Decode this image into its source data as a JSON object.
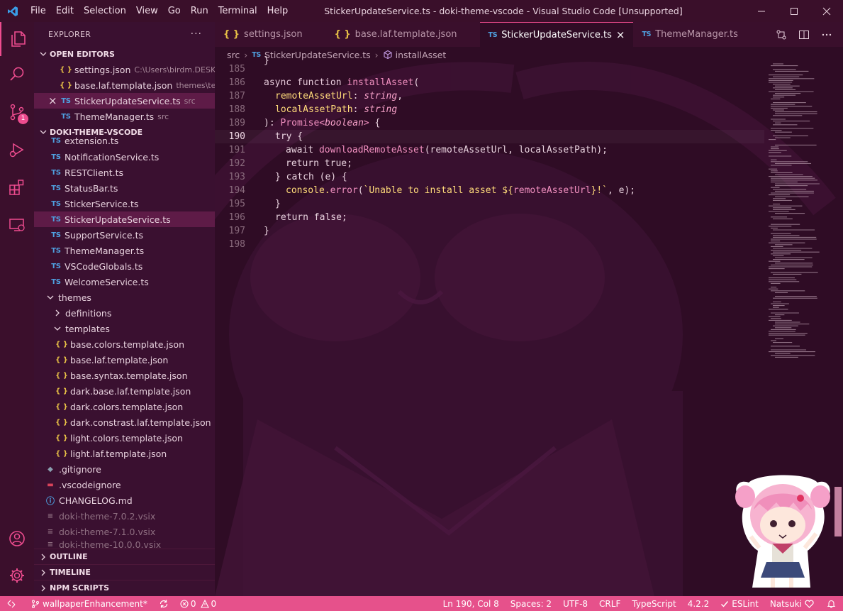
{
  "window": {
    "title": "StickerUpdateService.ts - doki-theme-vscode - Visual Studio Code [Unsupported]",
    "menus": [
      "File",
      "Edit",
      "Selection",
      "View",
      "Go",
      "Run",
      "Terminal",
      "Help"
    ]
  },
  "activity_bar": {
    "items": [
      "explorer-icon",
      "search-icon",
      "source-control-icon",
      "run-debug-icon",
      "extensions-icon",
      "remote-explorer-icon"
    ],
    "scm_badge": "1",
    "bottom": [
      "account-icon",
      "settings-gear-icon"
    ]
  },
  "sidebar": {
    "title": "EXPLORER",
    "more": "···",
    "open_editors": {
      "header": "OPEN EDITORS",
      "items": [
        {
          "icon": "{ }",
          "name": "settings.json",
          "desc": "C:\\Users\\birdm.DESK..."
        },
        {
          "icon": "{ }",
          "name": "base.laf.template.json",
          "desc": "themes\\te..."
        },
        {
          "icon": "TS",
          "name": "StickerUpdateService.ts",
          "desc": "src",
          "close": "×"
        },
        {
          "icon": "TS",
          "name": "ThemeManager.ts",
          "desc": "src"
        }
      ]
    },
    "workspace": {
      "header": "DOKI-THEME-VSCODE",
      "files": [
        {
          "icon": "TS",
          "name": "extension.ts"
        },
        {
          "icon": "TS",
          "name": "NotificationService.ts"
        },
        {
          "icon": "TS",
          "name": "RESTClient.ts"
        },
        {
          "icon": "TS",
          "name": "StatusBar.ts"
        },
        {
          "icon": "TS",
          "name": "StickerService.ts"
        },
        {
          "icon": "TS",
          "name": "StickerUpdateService.ts"
        },
        {
          "icon": "TS",
          "name": "SupportService.ts"
        },
        {
          "icon": "TS",
          "name": "ThemeManager.ts"
        },
        {
          "icon": "TS",
          "name": "VSCodeGlobals.ts"
        },
        {
          "icon": "TS",
          "name": "WelcomeService.ts"
        },
        {
          "icon": "",
          "name": "themes"
        },
        {
          "icon": "",
          "name": "definitions"
        },
        {
          "icon": "",
          "name": "templates"
        },
        {
          "icon": "{ }",
          "name": "base.colors.template.json"
        },
        {
          "icon": "{ }",
          "name": "base.laf.template.json"
        },
        {
          "icon": "{ }",
          "name": "base.syntax.template.json"
        },
        {
          "icon": "{ }",
          "name": "dark.base.laf.template.json"
        },
        {
          "icon": "{ }",
          "name": "dark.colors.template.json"
        },
        {
          "icon": "{ }",
          "name": "dark.constrast.laf.template.json"
        },
        {
          "icon": "{ }",
          "name": "light.colors.template.json"
        },
        {
          "icon": "{ }",
          "name": "light.laf.template.json"
        },
        {
          "icon": "◆",
          "name": ".gitignore"
        },
        {
          "icon": "▬",
          "name": ".vscodeignore"
        },
        {
          "icon": "ⓘ",
          "name": "CHANGELOG.md"
        },
        {
          "icon": "≡",
          "name": "doki-theme-7.0.2.vsix"
        },
        {
          "icon": "≡",
          "name": "doki-theme-7.1.0.vsix"
        },
        {
          "icon": "≡",
          "name": "doki-theme-10.0.0.vsix"
        }
      ]
    },
    "bottom_sections": [
      "OUTLINE",
      "TIMELINE",
      "NPM SCRIPTS"
    ]
  },
  "editor": {
    "tabs": [
      {
        "icon": "{ }",
        "label": "settings.json"
      },
      {
        "icon": "{ }",
        "label": "base.laf.template.json"
      },
      {
        "icon": "TS",
        "label": "StickerUpdateService.ts",
        "close": "×"
      },
      {
        "icon": "TS",
        "label": "ThemeManager.ts"
      }
    ],
    "breadcrumbs": [
      "src",
      "StickerUpdateService.ts",
      "installAsset"
    ],
    "breadcrumb_icon": "TS",
    "line_numbers": [
      "185",
      "186",
      "187",
      "188",
      "189",
      "190",
      "191",
      "192",
      "193",
      "194",
      "195",
      "196",
      "197",
      "198"
    ],
    "current_line": "190",
    "code": {
      "l185": "}",
      "l186a": "async function ",
      "l186b": "installAsset",
      "l186c": "(",
      "l187a": "remoteAssetUrl",
      "l187b": ": ",
      "l187c": "string",
      "l187d": ",",
      "l188a": "localAssetPath",
      "l188b": ": ",
      "l188c": "string",
      "l189a": "): ",
      "l189b": "Promise<",
      "l189c": "boolean",
      "l189d": ">",
      "l189e": " {",
      "l190": "try {",
      "l191a": "await ",
      "l191b": "downloadRemoteAsset",
      "l191c": "(remoteAssetUrl, localAssetPath);",
      "l192": "return true;",
      "l193": "} catch (e) {",
      "l194a": "console.",
      "l194b": "error",
      "l194c": "(",
      "l194d": "`Unable to install asset ${",
      "l194e": "remoteAssetUrl",
      "l194f": "}!`",
      "l194g": ", e);",
      "l195": "}",
      "l196": "return false;",
      "l197": "}"
    }
  },
  "status_bar": {
    "branch": "wallpaperEnhancement*",
    "errors": "0",
    "warnings": "0",
    "position": "Ln 190, Col 8",
    "spaces": "Spaces: 2",
    "encoding": "UTF-8",
    "eol": "CRLF",
    "language": "TypeScript",
    "version": "4.2.2",
    "eslint": "ESLint",
    "theme": "Natsuki"
  },
  "colors": {
    "accent": "#e6518b",
    "background": "#2f0c25",
    "sidebar": "#3a1030",
    "selection": "#5e1b47"
  }
}
